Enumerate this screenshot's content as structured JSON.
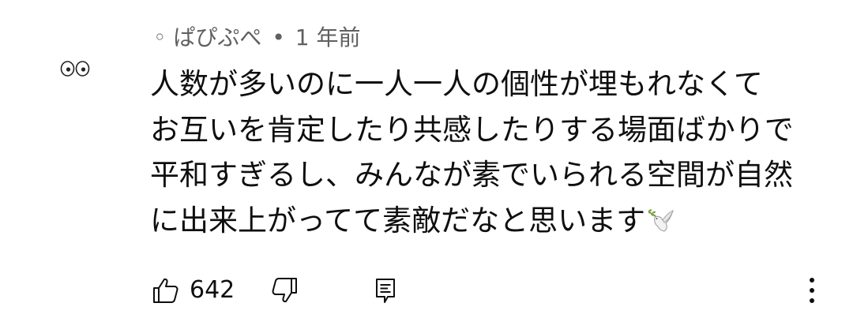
{
  "comment": {
    "author": "ぱぴぷぺ",
    "bullet_prefix": "◦",
    "separator": "•",
    "age": "1 年前",
    "lines": [
      "人数が多いのに一人一人の個性が埋もれなくて",
      "お互いを肯定したり共感したりする場面ばかりで",
      "平和すぎるし、みんなが素でいられる空間が自然",
      "に出来上がってて素敵だなと思います"
    ],
    "trailing_emoji": "dove-icon",
    "like_count": "642"
  },
  "icons": {
    "avatar": "eyes-icon",
    "like": "thumbs-up-icon",
    "dislike": "thumbs-down-icon",
    "reply": "reply-icon",
    "more": "more-vert-icon"
  },
  "colors": {
    "text_primary": "#0f0f0f",
    "text_secondary": "#606060",
    "background": "#ffffff"
  }
}
